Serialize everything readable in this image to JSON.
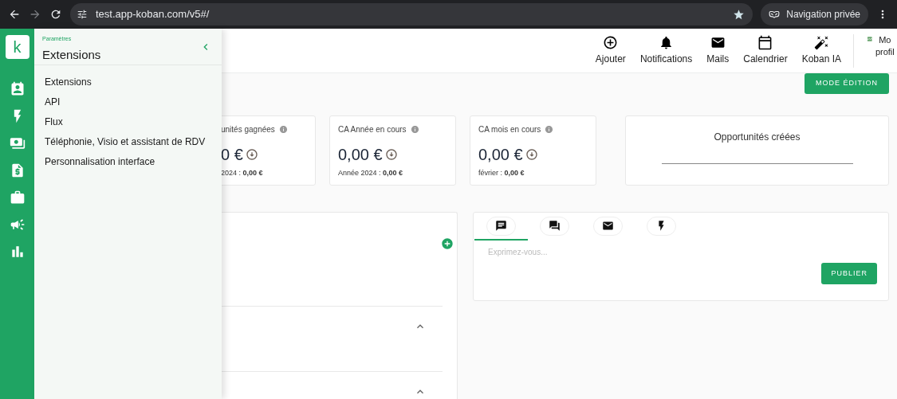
{
  "browser": {
    "url": "test.app-koban.com/v5#/",
    "forward_disabled": true,
    "incognito_label": "Navigation privée"
  },
  "rail": {
    "logo": "k",
    "items": [
      {
        "kind": "contacts"
      },
      {
        "kind": "bolt"
      },
      {
        "kind": "cash"
      },
      {
        "kind": "invoice"
      },
      {
        "kind": "briefcase"
      },
      {
        "kind": "megaphone"
      },
      {
        "kind": "chart"
      }
    ]
  },
  "drawer": {
    "breadcrumb": "Paramètres",
    "title": "Extensions",
    "items": [
      {
        "label": "Extensions"
      },
      {
        "label": "API"
      },
      {
        "label": "Flux"
      },
      {
        "label": "Téléphonie, Visio et assistant de RDV"
      },
      {
        "label": "Personnalisation interface"
      }
    ]
  },
  "header_nav": [
    {
      "kind": "add",
      "label": "Ajouter"
    },
    {
      "kind": "bell",
      "label": "Notifications"
    },
    {
      "kind": "mail",
      "label": "Mails"
    },
    {
      "kind": "calendar",
      "label": "Calendrier"
    },
    {
      "kind": "wand",
      "label": "Koban IA"
    }
  ],
  "profile": {
    "alt_text": "Mo profil"
  },
  "mode_button": "MODE ÉDITION",
  "stat_cards": [
    {
      "title": "unités gagnées",
      "value": "0 €",
      "sub": "2024 : **0,00 €**"
    },
    {
      "title": "CA Année en cours",
      "value": "0,00 €",
      "sub": "Année 2024 : **0,00 €**"
    },
    {
      "title": "CA mois en cours",
      "value": "0,00 €",
      "sub": "février : **0,00 €**"
    }
  ],
  "chart_card": {
    "title": "Opportunités créées"
  },
  "list_panel": {
    "sections": [
      {
        "expanded": true
      },
      {
        "expanded": true
      }
    ]
  },
  "feed": {
    "tabs": [
      {
        "kind": "comment",
        "selected": true
      },
      {
        "kind": "chat",
        "selected": false
      },
      {
        "kind": "mail",
        "selected": false
      },
      {
        "kind": "bolt",
        "selected": false
      }
    ],
    "placeholder": "Exprimez-vous...",
    "button": "PUBLIER"
  }
}
